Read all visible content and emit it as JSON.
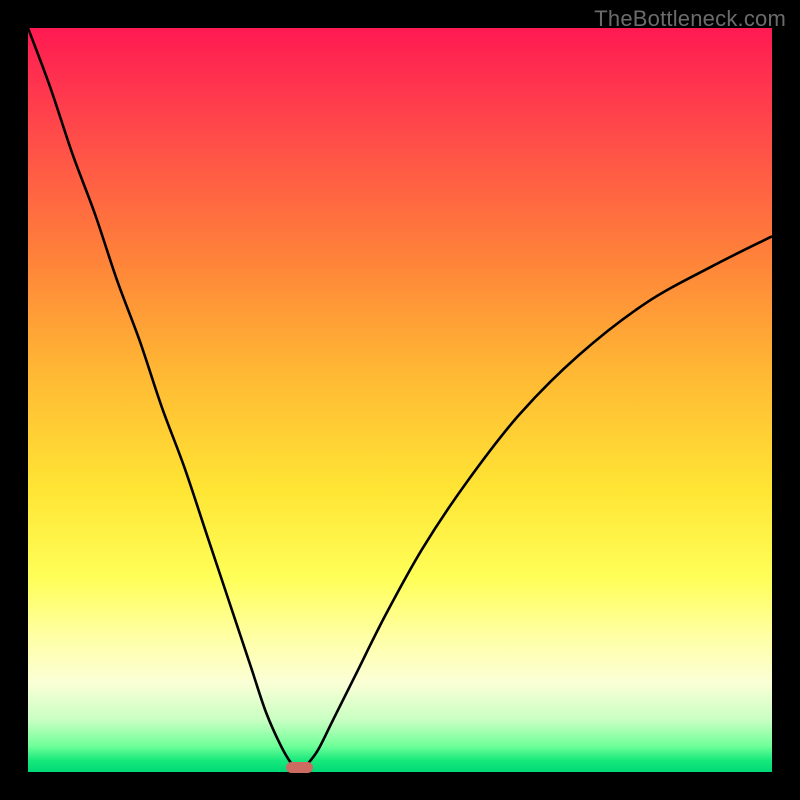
{
  "watermark": {
    "text": "TheBottleneck.com"
  },
  "chart_data": {
    "type": "line",
    "title": "",
    "xlabel": "",
    "ylabel": "",
    "xlim": [
      0,
      100
    ],
    "ylim": [
      0,
      100
    ],
    "grid": false,
    "legend": false,
    "series": [
      {
        "name": "curve",
        "x": [
          0,
          3,
          6,
          9,
          12,
          15,
          18,
          21,
          24,
          27,
          30,
          32,
          34,
          35.5,
          36.5,
          37.5,
          39,
          41,
          44,
          48,
          53,
          59,
          66,
          74,
          83,
          92,
          100
        ],
        "y": [
          100,
          92,
          83,
          75,
          66,
          58,
          49,
          41,
          32,
          23,
          14,
          8,
          3.5,
          1,
          0.1,
          1,
          3,
          7,
          13,
          21,
          30,
          39,
          48,
          56,
          63,
          68,
          72
        ]
      }
    ],
    "marker": {
      "shape": "rounded-rect",
      "x": 36.5,
      "y": 0.6,
      "width_pct": 3.6,
      "height_pct": 1.4,
      "color": "#cb6b62"
    },
    "gradient_stops": [
      {
        "pct": 0,
        "color": "#ff1a52"
      },
      {
        "pct": 14,
        "color": "#ff4a4a"
      },
      {
        "pct": 30,
        "color": "#ff7f3a"
      },
      {
        "pct": 46,
        "color": "#ffb734"
      },
      {
        "pct": 62,
        "color": "#ffe534"
      },
      {
        "pct": 74,
        "color": "#ffff59"
      },
      {
        "pct": 82,
        "color": "#ffffa6"
      },
      {
        "pct": 88,
        "color": "#fbffd6"
      },
      {
        "pct": 93,
        "color": "#c9ffc3"
      },
      {
        "pct": 96.5,
        "color": "#6fff99"
      },
      {
        "pct": 98.5,
        "color": "#16e87b"
      },
      {
        "pct": 100,
        "color": "#00d977"
      }
    ],
    "curve_style": {
      "stroke": "#000000",
      "stroke_width_px": 2.6
    }
  }
}
